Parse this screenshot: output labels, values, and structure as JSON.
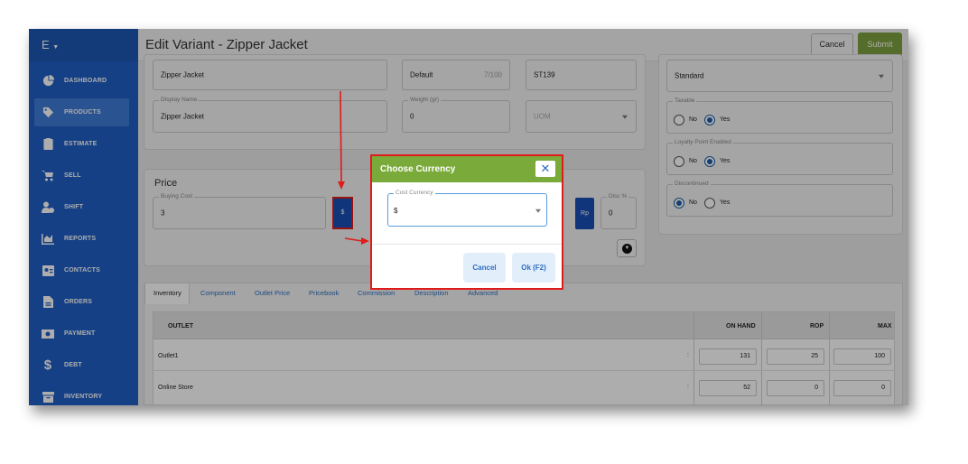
{
  "sidebar": {
    "logo": "E",
    "items": [
      {
        "label": "DASHBOARD",
        "icon": "dashboard-icon"
      },
      {
        "label": "PRODUCTS",
        "icon": "tag-icon"
      },
      {
        "label": "ESTIMATE",
        "icon": "clipboard-icon"
      },
      {
        "label": "SELL",
        "icon": "cart-icon"
      },
      {
        "label": "SHIFT",
        "icon": "user-clock-icon"
      },
      {
        "label": "REPORTS",
        "icon": "chart-icon"
      },
      {
        "label": "CONTACTS",
        "icon": "contact-card-icon"
      },
      {
        "label": "ORDERS",
        "icon": "file-icon"
      },
      {
        "label": "PAYMENT",
        "icon": "money-icon"
      },
      {
        "label": "DEBT",
        "icon": "dollar-icon"
      },
      {
        "label": "INVENTORY",
        "icon": "archive-icon"
      }
    ],
    "active_index": 1
  },
  "header": {
    "title": "Edit Variant - Zipper Jacket",
    "cancel_label": "Cancel",
    "submit_label": "Submit"
  },
  "form": {
    "name_value": "Zipper Jacket",
    "variant_value": "Default",
    "variant_counter": "7/100",
    "sku_value": "ST139",
    "display_name_label": "Display Name",
    "display_name_value": "Zipper Jacket",
    "weight_label": "Weight (gr)",
    "weight_value": "0",
    "uom_placeholder": "UOM"
  },
  "right_panel": {
    "type_value": "Standard",
    "taxable_label": "Taxable",
    "loyalty_label": "Loyalty Point Enabled",
    "discontinued_label": "Discontinued",
    "no_label": "No",
    "yes_label": "Yes"
  },
  "price": {
    "heading": "Price",
    "buying_cost_label": "Buying Cost",
    "buying_cost_value": "3",
    "currency_button": "$",
    "currency_button_2": "Rp",
    "disc_label": "Disc %",
    "disc_value": "0"
  },
  "tabs": [
    "Inventory",
    "Component",
    "Outlet Price",
    "Pricebook",
    "Commission",
    "Description",
    "Advanced"
  ],
  "inventory_table": {
    "headers": [
      "OUTLET",
      "ON HAND",
      "ROP",
      "MAX"
    ],
    "rows": [
      {
        "outlet": "Outlet1",
        "on_hand": "131",
        "rop": "25",
        "max": "100"
      },
      {
        "outlet": "Online Store",
        "on_hand": "52",
        "rop": "0",
        "max": "0"
      }
    ]
  },
  "modal": {
    "title": "Choose Currency",
    "close_symbol": "✕",
    "field_label": "Cost Currency",
    "field_value": "$",
    "cancel_label": "Cancel",
    "ok_label": "Ok (F2)"
  },
  "colors": {
    "sidebar": "#1f5fc4",
    "modal_header": "#7aab3a",
    "submit": "#7da13e",
    "highlight_border": "#e01b1b",
    "currency_button": "#1a4fb5"
  }
}
